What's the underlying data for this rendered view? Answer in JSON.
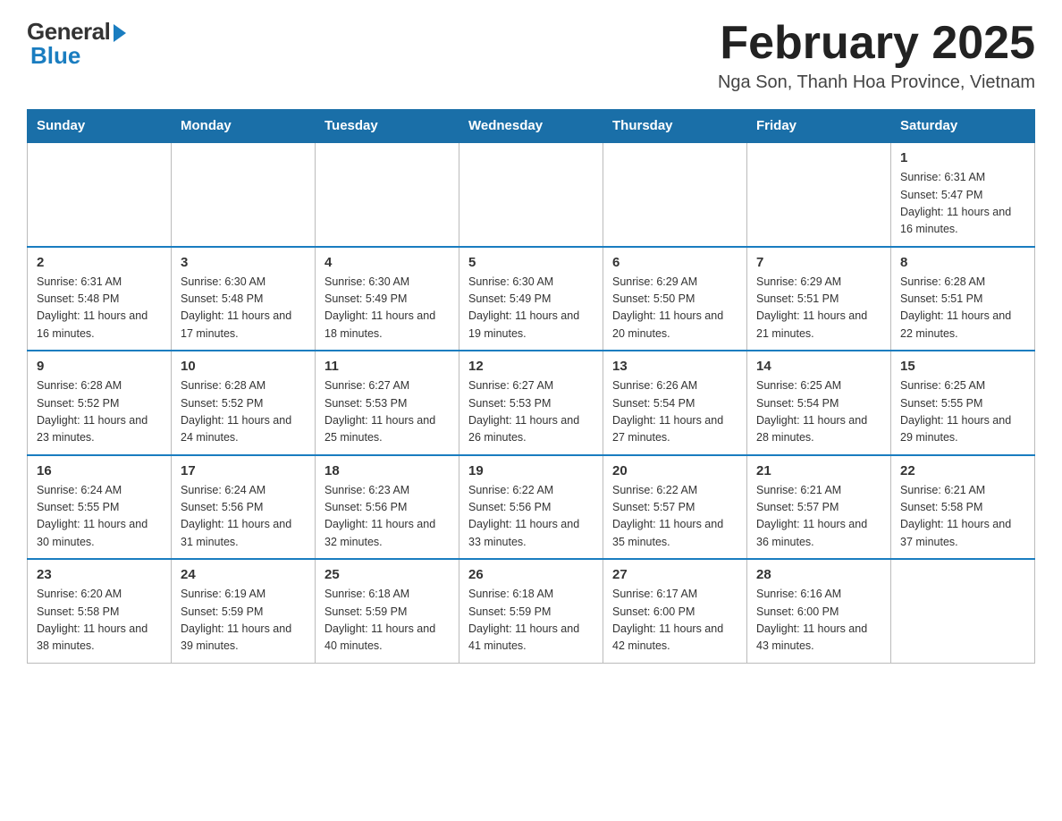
{
  "header": {
    "logo_general": "General",
    "logo_blue": "Blue",
    "month_title": "February 2025",
    "location": "Nga Son, Thanh Hoa Province, Vietnam"
  },
  "days_of_week": [
    "Sunday",
    "Monday",
    "Tuesday",
    "Wednesday",
    "Thursday",
    "Friday",
    "Saturday"
  ],
  "weeks": [
    [
      {
        "day": "",
        "info": ""
      },
      {
        "day": "",
        "info": ""
      },
      {
        "day": "",
        "info": ""
      },
      {
        "day": "",
        "info": ""
      },
      {
        "day": "",
        "info": ""
      },
      {
        "day": "",
        "info": ""
      },
      {
        "day": "1",
        "info": "Sunrise: 6:31 AM\nSunset: 5:47 PM\nDaylight: 11 hours and 16 minutes."
      }
    ],
    [
      {
        "day": "2",
        "info": "Sunrise: 6:31 AM\nSunset: 5:48 PM\nDaylight: 11 hours and 16 minutes."
      },
      {
        "day": "3",
        "info": "Sunrise: 6:30 AM\nSunset: 5:48 PM\nDaylight: 11 hours and 17 minutes."
      },
      {
        "day": "4",
        "info": "Sunrise: 6:30 AM\nSunset: 5:49 PM\nDaylight: 11 hours and 18 minutes."
      },
      {
        "day": "5",
        "info": "Sunrise: 6:30 AM\nSunset: 5:49 PM\nDaylight: 11 hours and 19 minutes."
      },
      {
        "day": "6",
        "info": "Sunrise: 6:29 AM\nSunset: 5:50 PM\nDaylight: 11 hours and 20 minutes."
      },
      {
        "day": "7",
        "info": "Sunrise: 6:29 AM\nSunset: 5:51 PM\nDaylight: 11 hours and 21 minutes."
      },
      {
        "day": "8",
        "info": "Sunrise: 6:28 AM\nSunset: 5:51 PM\nDaylight: 11 hours and 22 minutes."
      }
    ],
    [
      {
        "day": "9",
        "info": "Sunrise: 6:28 AM\nSunset: 5:52 PM\nDaylight: 11 hours and 23 minutes."
      },
      {
        "day": "10",
        "info": "Sunrise: 6:28 AM\nSunset: 5:52 PM\nDaylight: 11 hours and 24 minutes."
      },
      {
        "day": "11",
        "info": "Sunrise: 6:27 AM\nSunset: 5:53 PM\nDaylight: 11 hours and 25 minutes."
      },
      {
        "day": "12",
        "info": "Sunrise: 6:27 AM\nSunset: 5:53 PM\nDaylight: 11 hours and 26 minutes."
      },
      {
        "day": "13",
        "info": "Sunrise: 6:26 AM\nSunset: 5:54 PM\nDaylight: 11 hours and 27 minutes."
      },
      {
        "day": "14",
        "info": "Sunrise: 6:25 AM\nSunset: 5:54 PM\nDaylight: 11 hours and 28 minutes."
      },
      {
        "day": "15",
        "info": "Sunrise: 6:25 AM\nSunset: 5:55 PM\nDaylight: 11 hours and 29 minutes."
      }
    ],
    [
      {
        "day": "16",
        "info": "Sunrise: 6:24 AM\nSunset: 5:55 PM\nDaylight: 11 hours and 30 minutes."
      },
      {
        "day": "17",
        "info": "Sunrise: 6:24 AM\nSunset: 5:56 PM\nDaylight: 11 hours and 31 minutes."
      },
      {
        "day": "18",
        "info": "Sunrise: 6:23 AM\nSunset: 5:56 PM\nDaylight: 11 hours and 32 minutes."
      },
      {
        "day": "19",
        "info": "Sunrise: 6:22 AM\nSunset: 5:56 PM\nDaylight: 11 hours and 33 minutes."
      },
      {
        "day": "20",
        "info": "Sunrise: 6:22 AM\nSunset: 5:57 PM\nDaylight: 11 hours and 35 minutes."
      },
      {
        "day": "21",
        "info": "Sunrise: 6:21 AM\nSunset: 5:57 PM\nDaylight: 11 hours and 36 minutes."
      },
      {
        "day": "22",
        "info": "Sunrise: 6:21 AM\nSunset: 5:58 PM\nDaylight: 11 hours and 37 minutes."
      }
    ],
    [
      {
        "day": "23",
        "info": "Sunrise: 6:20 AM\nSunset: 5:58 PM\nDaylight: 11 hours and 38 minutes."
      },
      {
        "day": "24",
        "info": "Sunrise: 6:19 AM\nSunset: 5:59 PM\nDaylight: 11 hours and 39 minutes."
      },
      {
        "day": "25",
        "info": "Sunrise: 6:18 AM\nSunset: 5:59 PM\nDaylight: 11 hours and 40 minutes."
      },
      {
        "day": "26",
        "info": "Sunrise: 6:18 AM\nSunset: 5:59 PM\nDaylight: 11 hours and 41 minutes."
      },
      {
        "day": "27",
        "info": "Sunrise: 6:17 AM\nSunset: 6:00 PM\nDaylight: 11 hours and 42 minutes."
      },
      {
        "day": "28",
        "info": "Sunrise: 6:16 AM\nSunset: 6:00 PM\nDaylight: 11 hours and 43 minutes."
      },
      {
        "day": "",
        "info": ""
      }
    ]
  ]
}
